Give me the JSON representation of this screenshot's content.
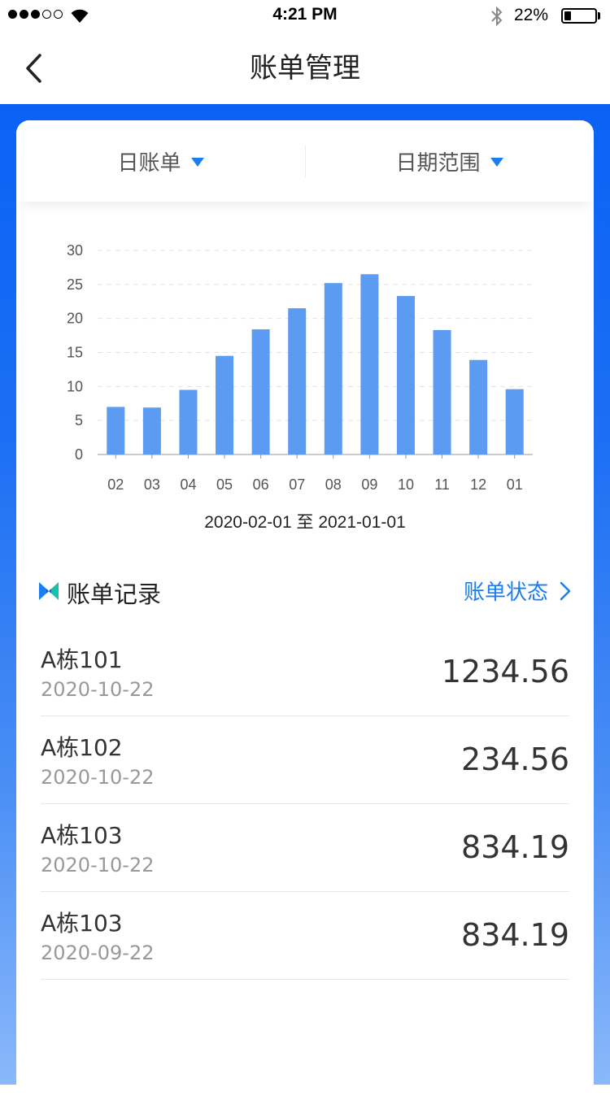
{
  "status_bar": {
    "time": "4:21 PM",
    "battery_pct": "22%",
    "battery_level": 0.22,
    "signal_bars": 3,
    "signal_total": 5,
    "icons": [
      "signal-icon",
      "wifi-icon",
      "bluetooth-icon",
      "battery-icon"
    ]
  },
  "nav": {
    "title": "账单管理",
    "back_icon": "chevron-left-icon"
  },
  "filters": [
    {
      "label": "日账单",
      "icon": "triangle-down-icon"
    },
    {
      "label": "日期范围",
      "icon": "triangle-down-icon"
    }
  ],
  "colors": {
    "accent": "#1a7ef2",
    "bar": "#5b9cf2",
    "bg_top": "#0a62f5",
    "bg_bottom": "#8ab8fa"
  },
  "chart_data": {
    "type": "bar",
    "categories": [
      "02",
      "03",
      "04",
      "05",
      "06",
      "07",
      "08",
      "09",
      "10",
      "11",
      "12",
      "01"
    ],
    "values": [
      7,
      6.9,
      9.5,
      14.5,
      18.4,
      21.5,
      25.2,
      26.5,
      23.3,
      18.3,
      13.9,
      9.6
    ],
    "yticks": [
      "0",
      "5",
      "10",
      "15",
      "20",
      "25",
      "30"
    ],
    "ylim": [
      0,
      30
    ],
    "grid": true,
    "range_label": "2020-02-01 至 2021-01-01"
  },
  "records": {
    "title": "账单记录",
    "status_link": "账单状态",
    "items": [
      {
        "name": "A栋101",
        "date": "2020-10-22",
        "amount": "1234.56"
      },
      {
        "name": "A栋102",
        "date": "2020-10-22",
        "amount": "234.56"
      },
      {
        "name": "A栋103",
        "date": "2020-10-22",
        "amount": "834.19"
      },
      {
        "name": "A栋103",
        "date": "2020-09-22",
        "amount": "834.19"
      }
    ]
  }
}
